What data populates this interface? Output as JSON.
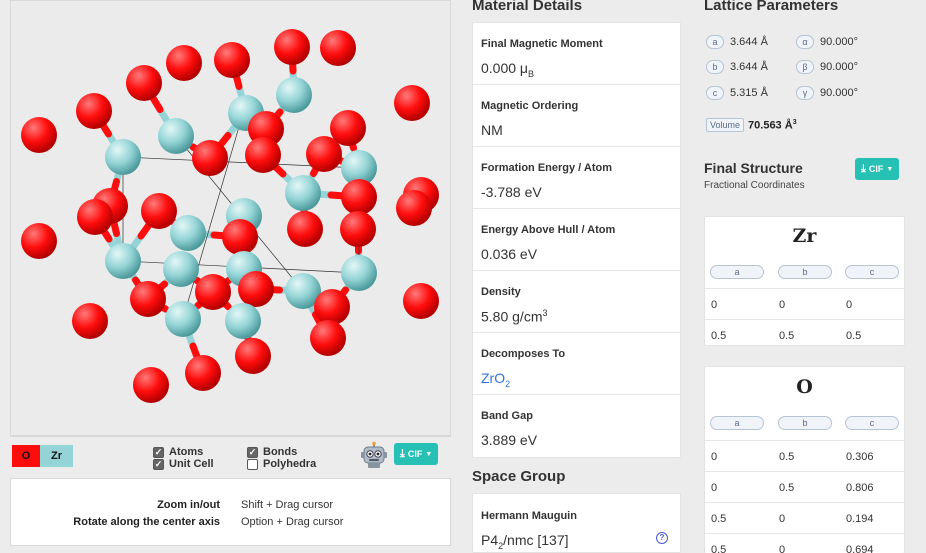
{
  "viewer": {
    "legend": {
      "o_label": "O",
      "zr_label": "Zr"
    },
    "checkboxes": {
      "atoms": {
        "label": "Atoms",
        "checked": true
      },
      "unit_cell": {
        "label": "Unit Cell",
        "checked": true
      },
      "bonds": {
        "label": "Bonds",
        "checked": true
      },
      "polyhedra": {
        "label": "Polyhedra",
        "checked": false
      }
    },
    "robot_icon": "robot-icon",
    "cif_label": "CIF",
    "help": [
      {
        "key": "Zoom in/out",
        "value": "Shift + Drag cursor"
      },
      {
        "key": "Rotate along the center axis",
        "value": "Option + Drag cursor"
      }
    ],
    "colors": {
      "oxygen": "#ff0d0d",
      "zirconium": "#94d4d6",
      "cif_button": "#26c0b5"
    }
  },
  "material_details": {
    "heading": "Material Details",
    "items": [
      {
        "label": "Final Magnetic Moment",
        "value": "0.000 μ",
        "sub": "B"
      },
      {
        "label": "Magnetic Ordering",
        "value": "NM"
      },
      {
        "label": "Formation Energy / Atom",
        "value": "-3.788 eV"
      },
      {
        "label": "Energy Above Hull / Atom",
        "value": "0.036 eV"
      },
      {
        "label": "Density",
        "value": "5.80 g/cm",
        "sup": "3"
      },
      {
        "label": "Decomposes To",
        "value": "ZrO",
        "sub": "2",
        "link": true
      },
      {
        "label": "Band Gap",
        "value": "3.889 eV"
      }
    ]
  },
  "space_group": {
    "heading": "Space Group",
    "label": "Hermann Mauguin",
    "value_pre": "P4",
    "value_sub": "2",
    "value_post": "/nmc [137]"
  },
  "lattice": {
    "heading": "Lattice Parameters",
    "params": [
      {
        "tag": "a",
        "value": "3.644 Å",
        "angle_tag": "α",
        "angle": "90.000°"
      },
      {
        "tag": "b",
        "value": "3.644 Å",
        "angle_tag": "β",
        "angle": "90.000°"
      },
      {
        "tag": "c",
        "value": "5.315 Å",
        "angle_tag": "γ",
        "angle": "90.000°"
      }
    ],
    "volume_tag": "Volume",
    "volume_value": "70.563 Å",
    "volume_sup": "3"
  },
  "final_structure": {
    "heading": "Final Structure",
    "subheading": "Fractional Coordinates",
    "cif_label": "CIF",
    "columns": [
      "a",
      "b",
      "c"
    ],
    "elements": [
      {
        "name": "Zr",
        "rows": [
          [
            "0",
            "0",
            "0"
          ],
          [
            "0.5",
            "0.5",
            "0.5"
          ]
        ]
      },
      {
        "name": "O",
        "rows": [
          [
            "0",
            "0.5",
            "0.306"
          ],
          [
            "0",
            "0.5",
            "0.806"
          ],
          [
            "0.5",
            "0",
            "0.194"
          ],
          [
            "0.5",
            "0",
            "0.694"
          ]
        ]
      }
    ]
  }
}
